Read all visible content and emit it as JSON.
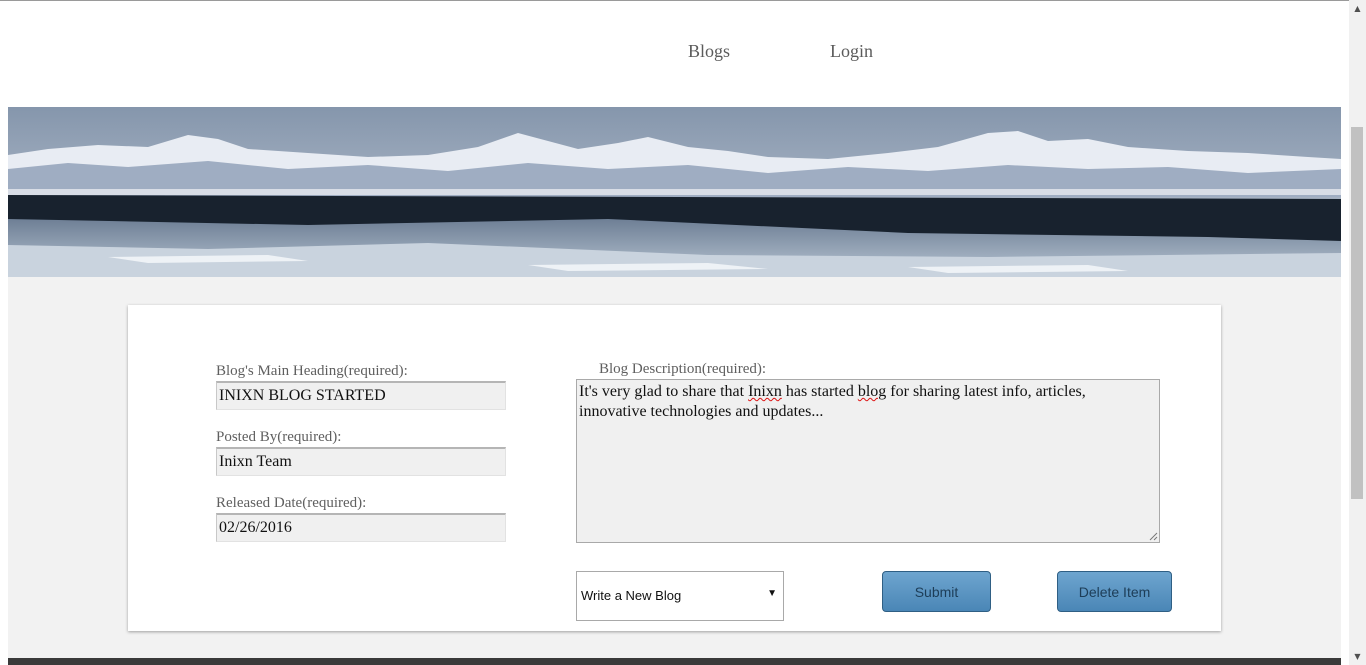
{
  "nav": {
    "blogs": "Blogs",
    "login": "Login"
  },
  "form": {
    "heading_label": "Blog's Main Heading(required):",
    "heading_value": "INIXN BLOG STARTED",
    "posted_by_label": "Posted By(required):",
    "posted_by_value": "Inixn Team",
    "release_date_label": "Released Date(required):",
    "release_date_value": "02/26/2016",
    "description_label": "Blog Description(required):",
    "description_parts": {
      "before": "It's very glad to share that  ",
      "word1": "Inixn",
      "middle": " has started ",
      "word2": "blog",
      "after": " for sharing latest info, articles, innovative technologies and updates..."
    },
    "mode_select": {
      "selected": "Write a New Blog",
      "arrow": "▼"
    },
    "submit_label": "Submit",
    "delete_label": "Delete Item"
  },
  "scrollbar": {
    "up_arrow": "▲",
    "down_arrow": "▼"
  }
}
